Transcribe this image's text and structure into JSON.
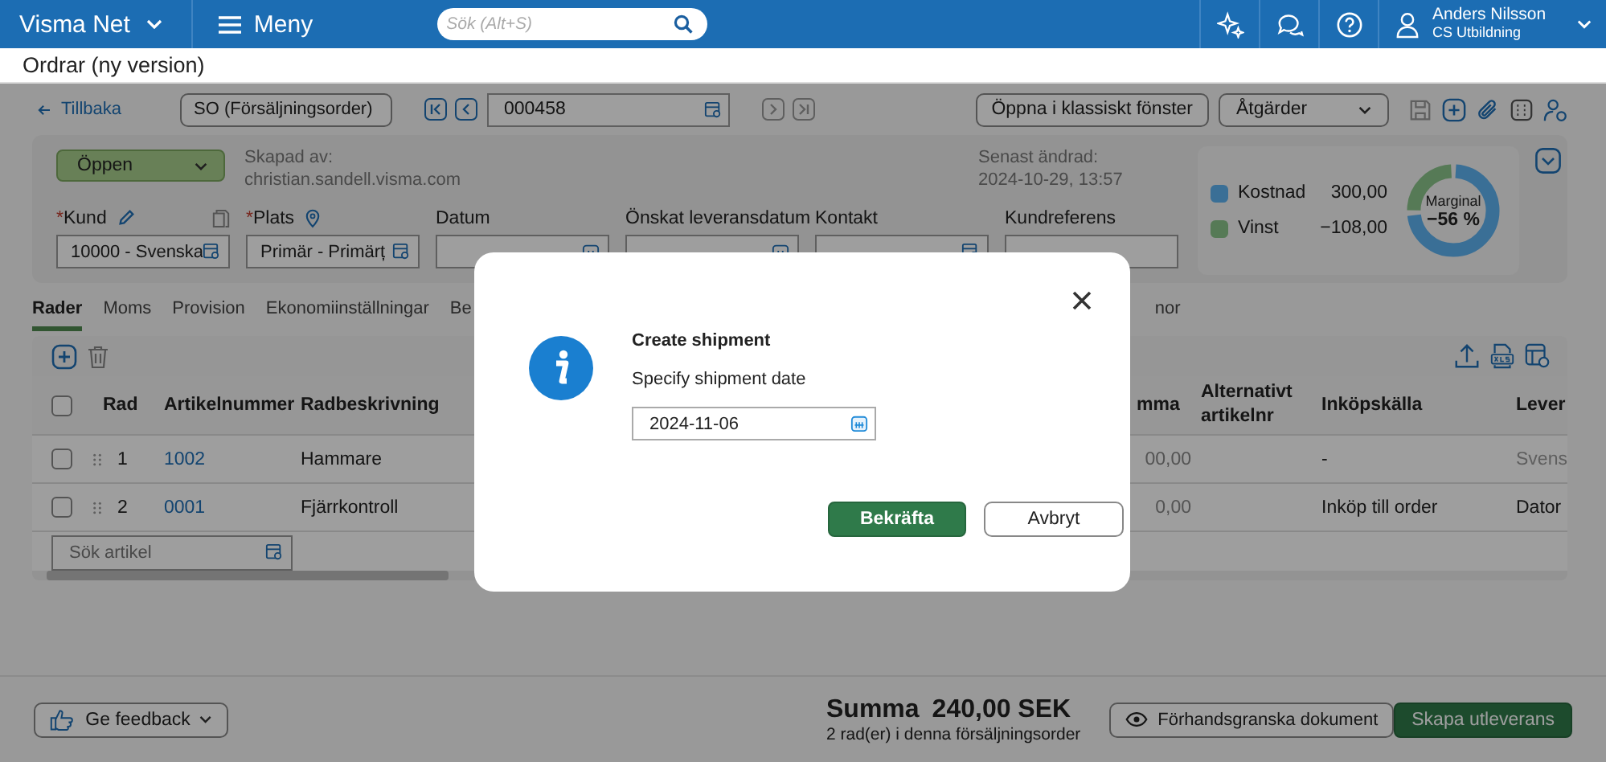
{
  "topbar": {
    "app": "Visma Net",
    "menu": "Meny",
    "search_placeholder": "Sök (Alt+S)",
    "user_name": "Anders Nilsson",
    "company": "CS Utbildning"
  },
  "page_title": "Ordrar (ny version)",
  "toolbar": {
    "back": "Tillbaka",
    "order_type": "SO (Försäljningsorder)",
    "order_number": "000458",
    "open_classic": "Öppna i klassiskt fönster",
    "actions": "Åtgärder"
  },
  "header": {
    "status": "Öppen",
    "created_label": "Skapad av:",
    "created_by": "christian.sandell.visma.com",
    "modified_label": "Senast ändrad:",
    "modified_at": "2024-10-29, 13:57",
    "fields": [
      {
        "kind": "customer",
        "required_mark": "*",
        "label": "Kund",
        "value": "10000 - Svenska"
      },
      {
        "kind": "location",
        "required_mark": "*",
        "label": "Plats",
        "value": "Primär - Primärț"
      },
      {
        "kind": "date",
        "label": "Datum"
      },
      {
        "kind": "date",
        "label": "Önskat leveransdatum"
      },
      {
        "kind": "contact",
        "label": "Kontakt"
      },
      {
        "kind": "text",
        "label": "Kundreferens"
      }
    ]
  },
  "margin": {
    "title": "Marginal",
    "percent": "−56 %",
    "items": [
      {
        "label": "Kostnad",
        "value": "300,00",
        "color": "#3a6f96"
      },
      {
        "label": "Vinst",
        "value": "−108,00",
        "color": "#577a57"
      }
    ]
  },
  "tabs": [
    {
      "label": "Rader",
      "selected": true
    },
    {
      "label": "Moms",
      "selected": false
    },
    {
      "label": "Provision",
      "selected": false
    },
    {
      "label": "Ekonomiinställningar",
      "selected": false
    },
    {
      "label": "Be",
      "selected": false
    },
    {
      "label": "nor",
      "selected": false
    }
  ],
  "grid": {
    "all_checked": false,
    "columns": [
      "Rad",
      "Artikelnummer",
      "Radbeskrivning",
      "mma",
      "Alternativt artikelnr",
      "Inköpskälla",
      "Lever"
    ],
    "rows": [
      {
        "checked": false,
        "rad": "1",
        "artikelnummer": "1002",
        "radbeskrivning": "Hammare",
        "column_4": "00,00",
        "inkopskalla": "-",
        "column_7": "Svens",
        "column_7_disabled": true
      },
      {
        "checked": false,
        "rad": "2",
        "artikelnummer": "0001",
        "radbeskrivning": "Fjärrkontroll",
        "column_4": "0,00",
        "inkopskalla": "Inköp till order",
        "column_7": "Dator",
        "column_7_disabled": false
      }
    ],
    "search_placeholder": "Sök artikel"
  },
  "footer": {
    "feedback": "Ge feedback",
    "sum_label": "Summa",
    "sum": "240,00 SEK",
    "rows_text": "2 rad(er) i denna försäljningsorder",
    "preview": "Förhandsgranska dokument",
    "create": "Skapa utleverans"
  },
  "dialog": {
    "title": "Create shipment",
    "message": "Specify shipment date",
    "date": "2024-11-06",
    "confirm": "Bekräfta",
    "cancel": "Avbryt"
  }
}
